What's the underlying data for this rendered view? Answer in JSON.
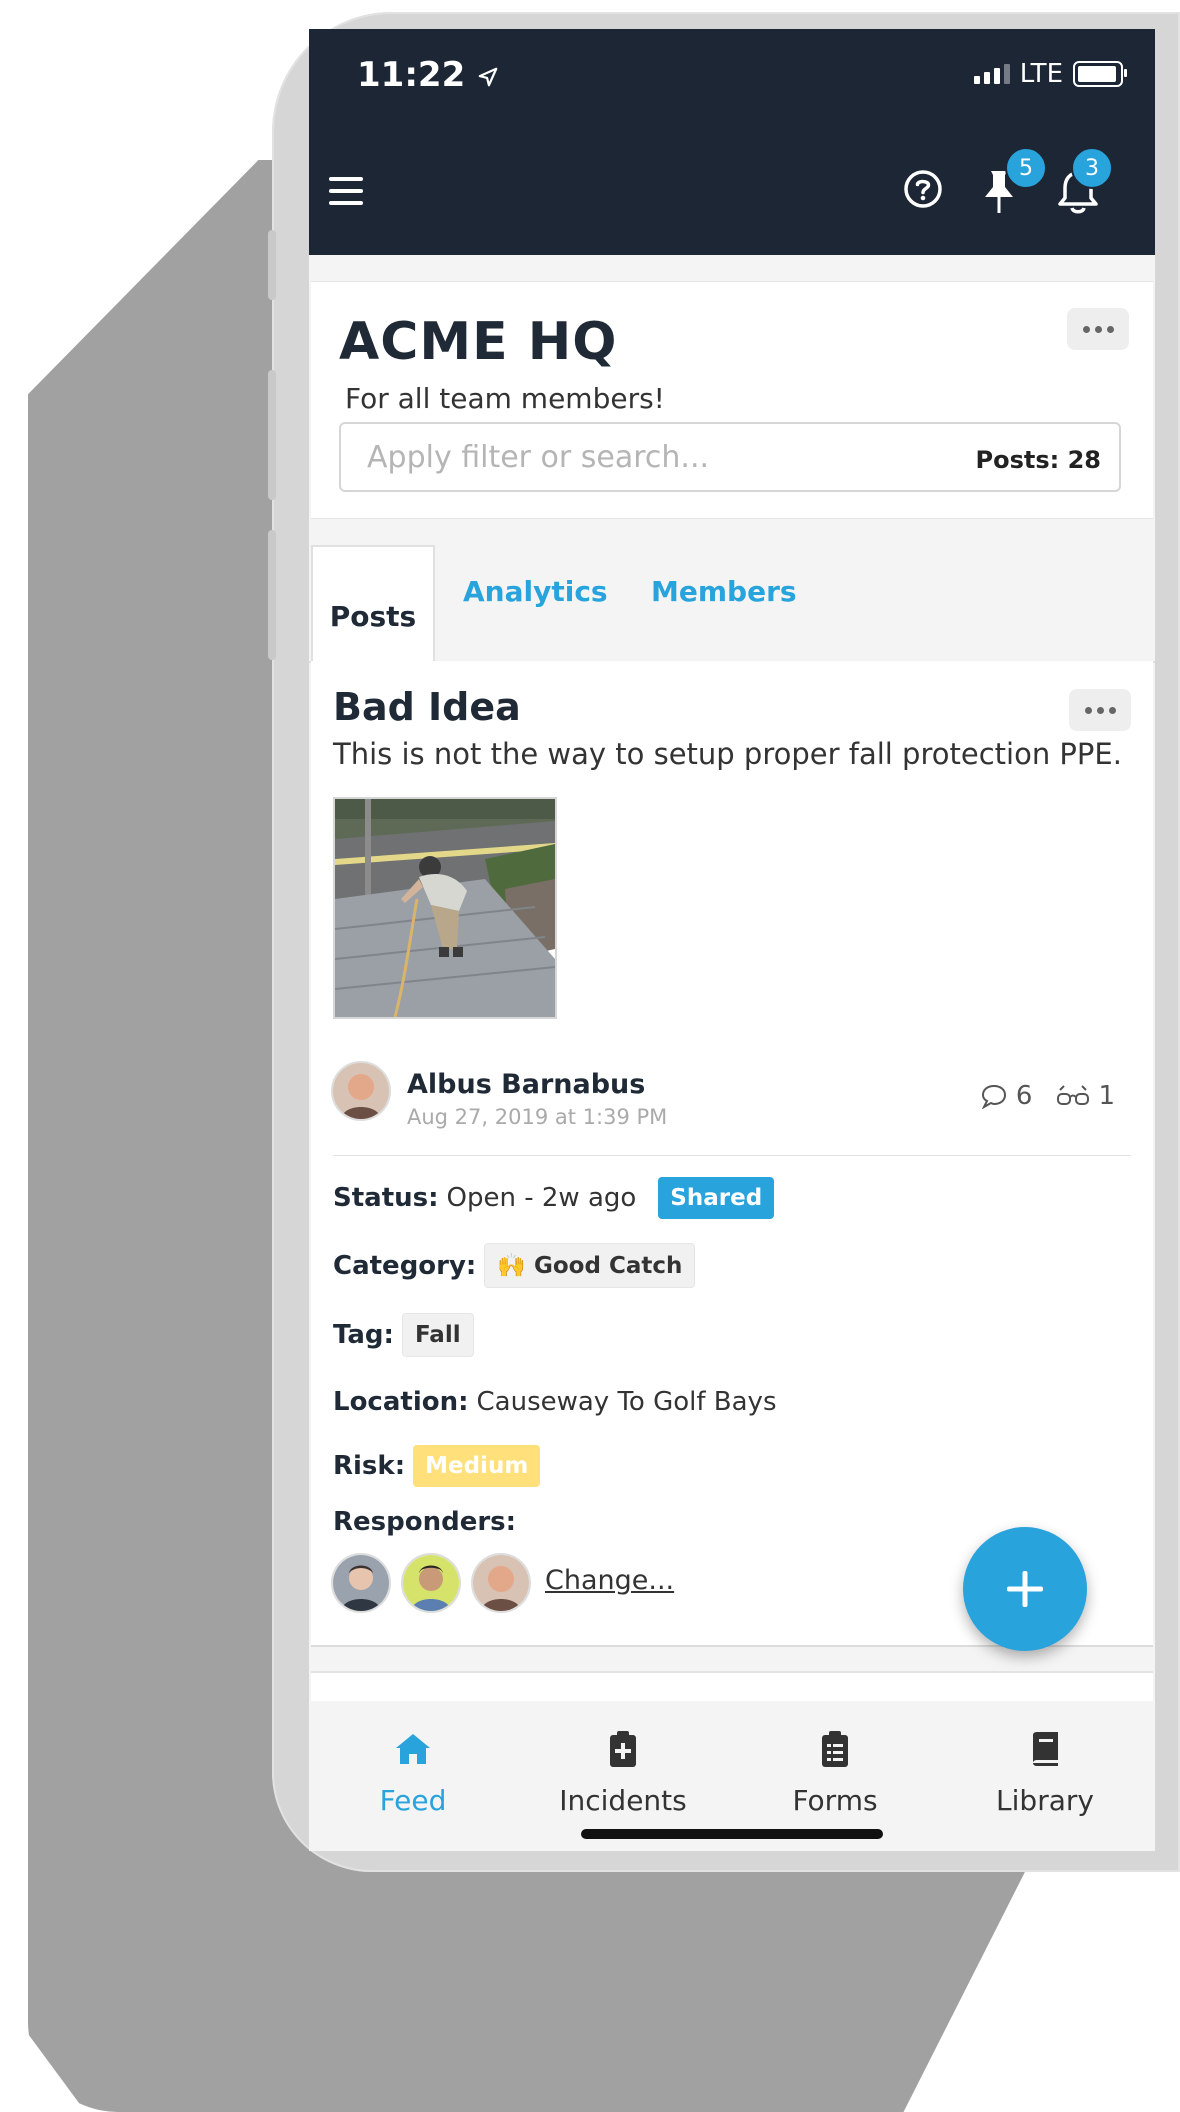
{
  "status_bar": {
    "time": "11:22",
    "network": "LTE"
  },
  "header": {
    "pinned_count": "5",
    "notification_count": "3"
  },
  "group": {
    "name": "ACME HQ",
    "subtitle": "For all team members!",
    "search_placeholder": "Apply filter or search...",
    "posts_count": "Posts: 28"
  },
  "tabs": [
    {
      "label": "Posts",
      "active": true
    },
    {
      "label": "Analytics",
      "active": false
    },
    {
      "label": "Members",
      "active": false
    }
  ],
  "post": {
    "title": "Bad Idea",
    "description": "This is not the way to setup proper fall protection PPE.",
    "author": "Albus Barnabus",
    "date": "Aug 27, 2019 at 1:39 PM",
    "comments": "6",
    "views": "1",
    "status_label": "Status:",
    "status_value": "Open - 2w ago",
    "shared_badge": "Shared",
    "category_label": "Category:",
    "category_emoji": "🙌",
    "category_value": "Good Catch",
    "tag_label": "Tag:",
    "tag_value": "Fall",
    "location_label": "Location:",
    "location_value": "Causeway To Golf Bays",
    "risk_label": "Risk:",
    "risk_value": "Medium",
    "responders_label": "Responders:",
    "change_link": "Change..."
  },
  "bottom_nav": [
    {
      "label": "Feed",
      "icon": "home-icon",
      "active": true
    },
    {
      "label": "Incidents",
      "icon": "clipboard-plus-icon",
      "active": false
    },
    {
      "label": "Forms",
      "icon": "clipboard-list-icon",
      "active": false
    },
    {
      "label": "Library",
      "icon": "book-icon",
      "active": false
    }
  ],
  "colors": {
    "accent": "#28a3dc",
    "nav_bar": "#1c2634",
    "risk_medium": "#ffe07a"
  }
}
